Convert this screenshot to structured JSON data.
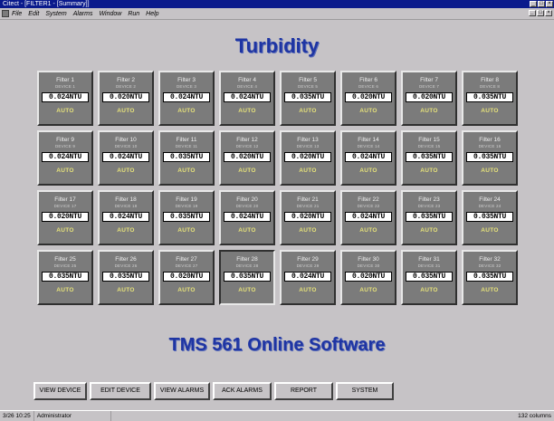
{
  "window": {
    "title": "Citect - [FILTER1 - [Summary]]",
    "controls": [
      "_",
      "□",
      "×"
    ]
  },
  "menu": {
    "items": [
      "File",
      "Edit",
      "System",
      "Alarms",
      "Window",
      "Run",
      "Help"
    ],
    "mdi_controls": [
      "_",
      "□",
      "×"
    ]
  },
  "page": {
    "heading": "Turbidity",
    "footer_title": "TMS 561 Online Software"
  },
  "filters": [
    {
      "name": "Filter 1",
      "device": "DEVICE 1",
      "value": "0.024NTU",
      "status": "AUTO"
    },
    {
      "name": "Filter 2",
      "device": "DEVICE 2",
      "value": "0.020NTU",
      "status": "AUTO"
    },
    {
      "name": "Filter 3",
      "device": "DEVICE 3",
      "value": "0.024NTU",
      "status": "AUTO"
    },
    {
      "name": "Filter 4",
      "device": "DEVICE 4",
      "value": "0.024NTU",
      "status": "AUTO"
    },
    {
      "name": "Filter 5",
      "device": "DEVICE 5",
      "value": "0.035NTU",
      "status": "AUTO"
    },
    {
      "name": "Filter 6",
      "device": "DEVICE 6",
      "value": "0.020NTU",
      "status": "AUTO"
    },
    {
      "name": "Filter 7",
      "device": "DEVICE 7",
      "value": "0.020NTU",
      "status": "AUTO"
    },
    {
      "name": "Filter 8",
      "device": "DEVICE 8",
      "value": "0.035NTU",
      "status": "AUTO"
    },
    {
      "name": "Filter 9",
      "device": "DEVICE 9",
      "value": "0.024NTU",
      "status": "AUTO"
    },
    {
      "name": "Filter 10",
      "device": "DEVICE 10",
      "value": "0.024NTU",
      "status": "AUTO"
    },
    {
      "name": "Filter 11",
      "device": "DEVICE 11",
      "value": "0.035NTU",
      "status": "AUTO"
    },
    {
      "name": "Filter 12",
      "device": "DEVICE 12",
      "value": "0.020NTU",
      "status": "AUTO"
    },
    {
      "name": "Filter 13",
      "device": "DEVICE 13",
      "value": "0.020NTU",
      "status": "AUTO"
    },
    {
      "name": "Filter 14",
      "device": "DEVICE 14",
      "value": "0.024NTU",
      "status": "AUTO"
    },
    {
      "name": "Filter 15",
      "device": "DEVICE 15",
      "value": "0.035NTU",
      "status": "AUTO"
    },
    {
      "name": "Filter 16",
      "device": "DEVICE 16",
      "value": "0.035NTU",
      "status": "AUTO"
    },
    {
      "name": "Filter 17",
      "device": "DEVICE 17",
      "value": "0.020NTU",
      "status": "AUTO"
    },
    {
      "name": "Filter 18",
      "device": "DEVICE 18",
      "value": "0.024NTU",
      "status": "AUTO"
    },
    {
      "name": "Filter 19",
      "device": "DEVICE 19",
      "value": "0.035NTU",
      "status": "AUTO"
    },
    {
      "name": "Filter 20",
      "device": "DEVICE 20",
      "value": "0.024NTU",
      "status": "AUTO"
    },
    {
      "name": "Filter 21",
      "device": "DEVICE 21",
      "value": "0.020NTU",
      "status": "AUTO"
    },
    {
      "name": "Filter 22",
      "device": "DEVICE 22",
      "value": "0.024NTU",
      "status": "AUTO"
    },
    {
      "name": "Filter 23",
      "device": "DEVICE 23",
      "value": "0.035NTU",
      "status": "AUTO"
    },
    {
      "name": "Filter 24",
      "device": "DEVICE 24",
      "value": "0.035NTU",
      "status": "AUTO"
    },
    {
      "name": "Filter 25",
      "device": "DEVICE 25",
      "value": "0.035NTU",
      "status": "AUTO"
    },
    {
      "name": "Filter 26",
      "device": "DEVICE 26",
      "value": "0.035NTU",
      "status": "AUTO"
    },
    {
      "name": "Filter 27",
      "device": "DEVICE 27",
      "value": "0.020NTU",
      "status": "AUTO"
    },
    {
      "name": "Filter 28",
      "device": "DEVICE 28",
      "value": "0.035NTU",
      "status": "AUTO",
      "selected": true
    },
    {
      "name": "Filter 29",
      "device": "DEVICE 29",
      "value": "0.024NTU",
      "status": "AUTO"
    },
    {
      "name": "Filter 30",
      "device": "DEVICE 30",
      "value": "0.020NTU",
      "status": "AUTO"
    },
    {
      "name": "Filter 31",
      "device": "DEVICE 31",
      "value": "0.035NTU",
      "status": "AUTO"
    },
    {
      "name": "Filter 32",
      "device": "DEVICE 32",
      "value": "0.035NTU",
      "status": "AUTO"
    }
  ],
  "buttons": [
    {
      "id": "view-device",
      "label": "VIEW DEVICE"
    },
    {
      "id": "edit-device",
      "label": "EDIT DEVICE"
    },
    {
      "id": "view-alarms",
      "label": "VIEW ALARMS"
    },
    {
      "id": "ack-alarms",
      "label": "ACK ALARMS"
    },
    {
      "id": "report",
      "label": "REPORT"
    },
    {
      "id": "system",
      "label": "SYSTEM"
    }
  ],
  "statusbar": {
    "time": "3/26 10:25",
    "user": "Administrator",
    "right": "132 columns"
  },
  "colors": {
    "title_bar": "#0a1a8c",
    "heading": "#1f35a3",
    "tile": "#7b7b7b",
    "status_text": "#e6e27a",
    "background": "#c6c3c6"
  }
}
